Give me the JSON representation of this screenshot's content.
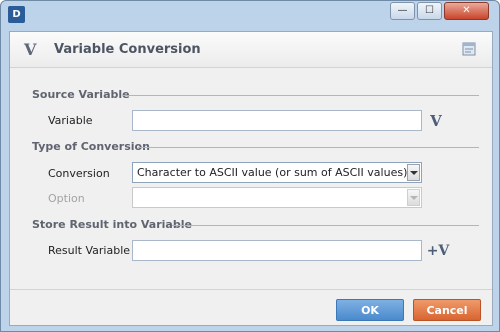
{
  "titlebar": {
    "logo_text": "D",
    "minimize_glyph": "—",
    "maximize_glyph": "☐",
    "close_glyph": "✕"
  },
  "header": {
    "icon_glyph": "V",
    "title": "Variable Conversion"
  },
  "source_section": {
    "title": "Source Variable",
    "variable_label": "Variable",
    "variable_value": "",
    "var_button_glyph": "V"
  },
  "conversion_section": {
    "title": "Type of Conversion",
    "conversion_label": "Conversion",
    "conversion_value": "Character to ASCII value (or sum of ASCII values)",
    "option_label": "Option",
    "option_value": ""
  },
  "result_section": {
    "title": "Store Result into Variable",
    "result_label": "Result Variable",
    "result_value": "",
    "var_button_glyph": "+V"
  },
  "footer": {
    "ok_label": "OK",
    "cancel_label": "Cancel"
  },
  "colors": {
    "ok": "#4a8acd",
    "cancel": "#d86530",
    "titlebar": "#bcd3ea"
  }
}
